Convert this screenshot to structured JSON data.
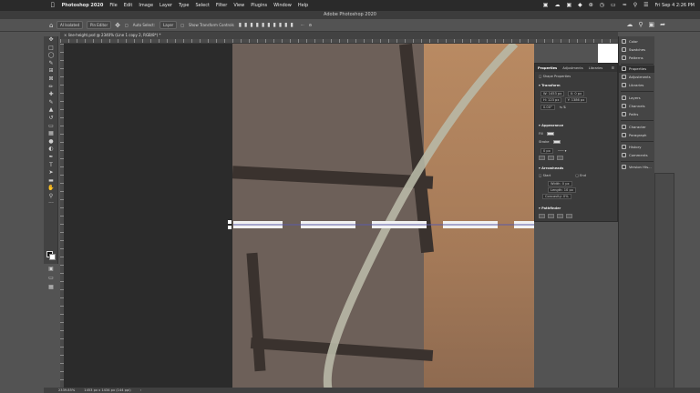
{
  "menubar": {
    "items": [
      "Photoshop 2020",
      "File",
      "Edit",
      "Image",
      "Layer",
      "Type",
      "Select",
      "Filter",
      "View",
      "Plugins",
      "Window",
      "Help"
    ],
    "datetime": "Fri Sep 4  2:26 PM"
  },
  "window": {
    "title": "Adobe Photoshop 2020"
  },
  "options": {
    "auto_select": "Auto Select:",
    "layer": "Layer",
    "show_transform": "Show Transform Controls",
    "chip1": "AI Isolated",
    "chip2": "Pin Editor"
  },
  "document": {
    "tab": "line-height.psd @ 2340% (Line 1 copy 2, RGB/8*) *"
  },
  "properties": {
    "tabs": [
      "Properties",
      "Adjustments",
      "Libraries"
    ],
    "shape_label": "Shape Properties",
    "transform": "Transform",
    "w": "W: 1453 px",
    "h": "H: 123 px",
    "x": "X: 0 px",
    "y": "Y: 1386 px",
    "angle": "0.00°",
    "appearance": "Appearance",
    "fill": "Fill",
    "stroke": "Stroke",
    "stroke_size": "0 px",
    "arrowheads": "Arrowheads",
    "start": "Start",
    "end": "End",
    "width": "Width: 0 px",
    "length": "Length: 10 px",
    "concavity": "Concavity: 0%",
    "pathfinder": "Pathfinder"
  },
  "dock": {
    "items": [
      "Color",
      "Swatches",
      "Patterns",
      "Properties",
      "Adjustments",
      "Libraries",
      "Layers",
      "Channels",
      "Paths",
      "Character",
      "Paragraph",
      "History",
      "Comments",
      "Version His..."
    ],
    "selected": "Properties"
  },
  "status": {
    "zoom": "2339.85%",
    "dims": "1453 px x 1434 px (144 ppi)"
  },
  "colors": {
    "accent": "#2e7bd6",
    "canvas_bg": "#2b2b2b"
  }
}
